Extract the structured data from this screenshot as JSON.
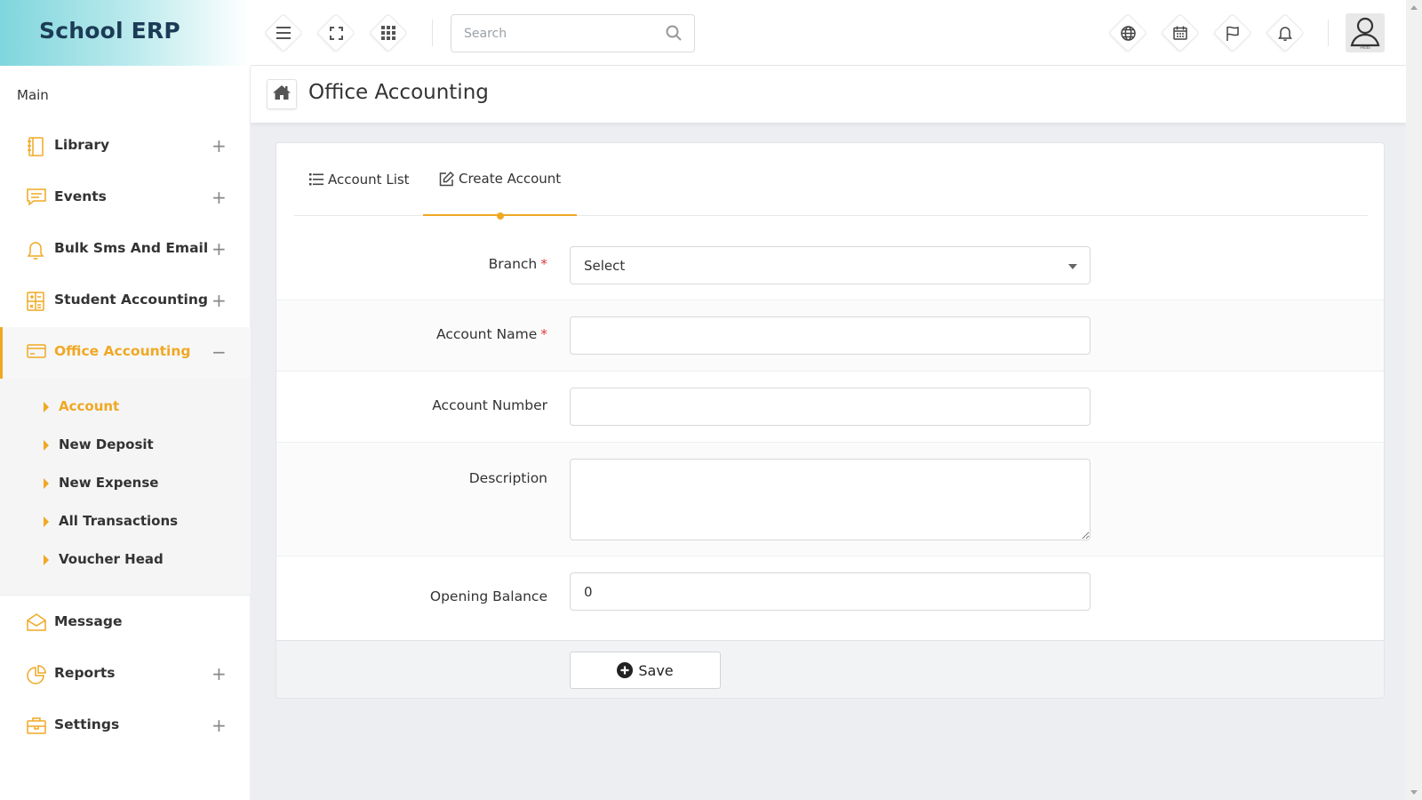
{
  "app": {
    "brand": "School ERP"
  },
  "header": {
    "search_placeholder": "Search",
    "left_buttons": [
      "menu-icon",
      "fullscreen-icon",
      "apps-grid-icon"
    ],
    "right_buttons": [
      "globe-icon",
      "calendar-icon",
      "flag-icon",
      "bell-icon"
    ],
    "avatar_caption": "Photo"
  },
  "sidebar": {
    "section": "Main",
    "items": [
      {
        "label": "Library",
        "icon": "book-icon",
        "toggle": "+"
      },
      {
        "label": "Events",
        "icon": "chat-icon",
        "toggle": "+"
      },
      {
        "label": "Bulk Sms And Email",
        "icon": "bell-icon",
        "toggle": "+"
      },
      {
        "label": "Student Accounting",
        "icon": "calculator-icon",
        "toggle": "+"
      },
      {
        "label": "Office Accounting",
        "icon": "credit-card-icon",
        "toggle": "−",
        "active": true
      },
      {
        "label": "Message",
        "icon": "envelope-icon",
        "toggle": ""
      },
      {
        "label": "Reports",
        "icon": "pie-chart-icon",
        "toggle": "+"
      },
      {
        "label": "Settings",
        "icon": "briefcase-icon",
        "toggle": "+"
      }
    ],
    "submenu": [
      {
        "label": "Account",
        "active": true
      },
      {
        "label": "New Deposit"
      },
      {
        "label": "New Expense"
      },
      {
        "label": "All Transactions"
      },
      {
        "label": "Voucher Head"
      }
    ]
  },
  "page": {
    "title": "Office Accounting"
  },
  "tabs": [
    {
      "label": "Account List",
      "icon": "list-icon"
    },
    {
      "label": "Create Account",
      "icon": "edit-icon",
      "active": true
    }
  ],
  "form": {
    "branch": {
      "label": "Branch",
      "required": "*",
      "value": "Select"
    },
    "account_name": {
      "label": "Account Name",
      "required": "*",
      "value": ""
    },
    "account_number": {
      "label": "Account Number",
      "value": ""
    },
    "description": {
      "label": "Description",
      "value": ""
    },
    "opening_balance": {
      "label": "Opening Balance",
      "value": "0"
    },
    "save_label": "Save"
  },
  "colors": {
    "accent": "#f0a824",
    "brand_text": "#1c3b56",
    "required": "#e03a3a"
  }
}
